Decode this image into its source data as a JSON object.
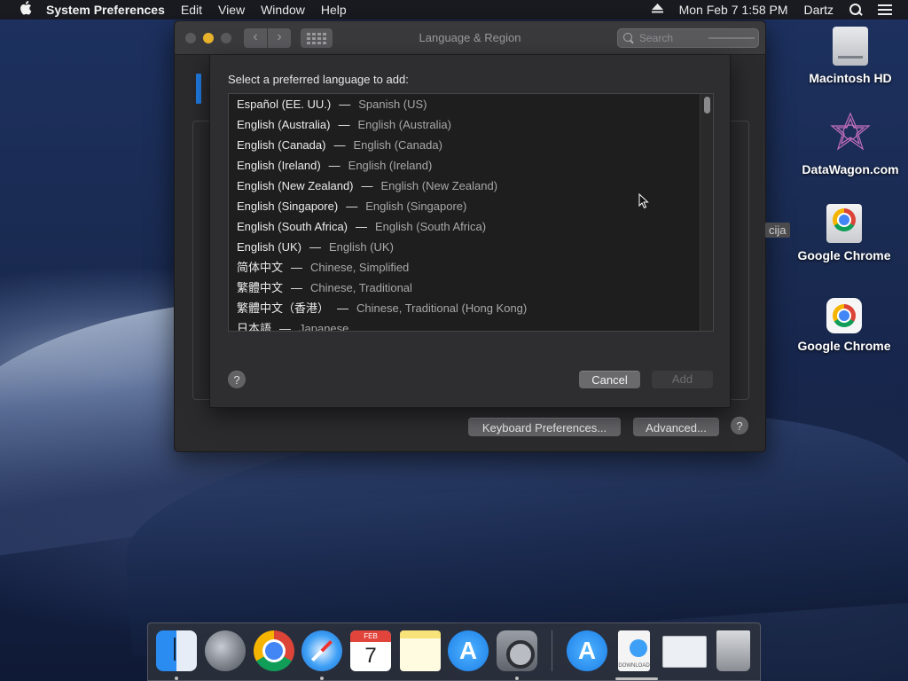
{
  "menubar": {
    "app_name": "System Preferences",
    "menus": [
      "Edit",
      "View",
      "Window",
      "Help"
    ],
    "clock": "Mon Feb 7  1:58 PM",
    "user": "Dartz"
  },
  "window": {
    "title": "Language & Region",
    "search_placeholder": "Search",
    "partial_label": "cija",
    "keyboard_button": "Keyboard Preferences...",
    "advanced_button": "Advanced...",
    "help_label": "?"
  },
  "sheet": {
    "prompt": "Select a preferred language to add:",
    "languages": [
      {
        "native": "Español (EE. UU.)",
        "english": "Spanish (US)"
      },
      {
        "native": "English (Australia)",
        "english": "English (Australia)"
      },
      {
        "native": "English (Canada)",
        "english": "English (Canada)"
      },
      {
        "native": "English (Ireland)",
        "english": "English (Ireland)"
      },
      {
        "native": "English (New Zealand)",
        "english": "English (New Zealand)"
      },
      {
        "native": "English (Singapore)",
        "english": "English (Singapore)"
      },
      {
        "native": "English (South Africa)",
        "english": "English (South Africa)"
      },
      {
        "native": "English (UK)",
        "english": "English (UK)"
      },
      {
        "native": "简体中文",
        "english": "Chinese, Simplified"
      },
      {
        "native": "繁體中文",
        "english": "Chinese, Traditional"
      },
      {
        "native": "繁體中文（香港）",
        "english": "Chinese, Traditional (Hong Kong)"
      },
      {
        "native": "日本語",
        "english": "Japanese"
      }
    ],
    "separator": "—",
    "help_label": "?",
    "cancel_label": "Cancel",
    "add_label": "Add"
  },
  "desktop": {
    "icons": [
      "Macintosh HD",
      "DataWagon.com",
      "Google Chrome",
      "Google Chrome"
    ]
  },
  "dock": {
    "calendar_month": "FEB",
    "calendar_day": "7",
    "download_label": "DOWNLOAD"
  },
  "colors": {
    "accent_blue": "#1f7ae0",
    "minimize_yellow": "#e8b32c"
  }
}
